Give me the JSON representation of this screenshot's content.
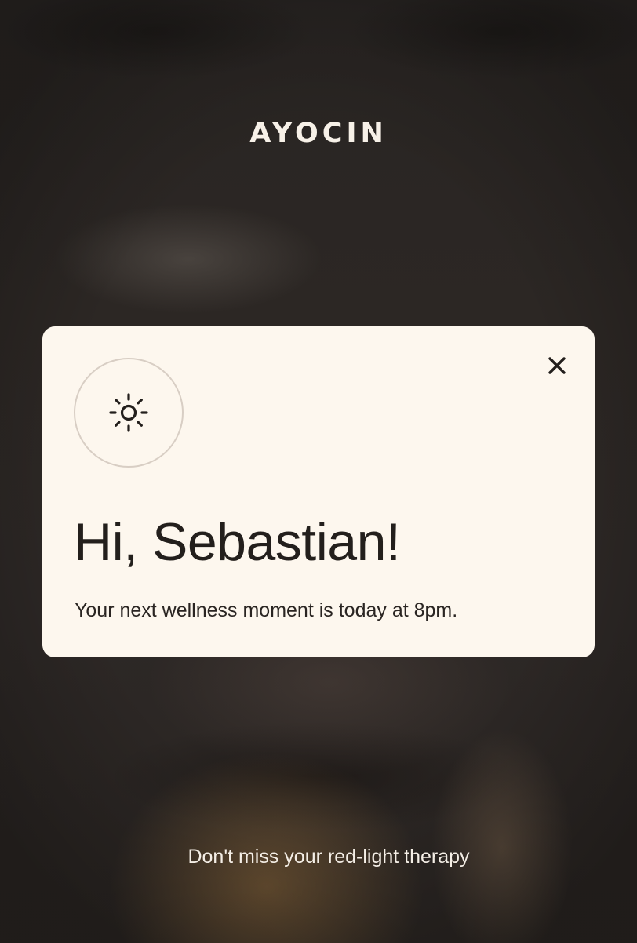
{
  "brand": {
    "logo_text": "AYOCIN"
  },
  "notification": {
    "icon": "sun-icon",
    "close_icon": "close-icon",
    "greeting": "Hi, Sebastian!",
    "message": "Your next wellness moment is today at 8pm."
  },
  "footer": {
    "text": "Don't miss your red-light therapy"
  },
  "colors": {
    "background": "#2a2522",
    "card": "#fdf7ee",
    "text_dark": "#231f1c",
    "text_light": "#f4eee6",
    "circle_border": "#d8cec4"
  }
}
